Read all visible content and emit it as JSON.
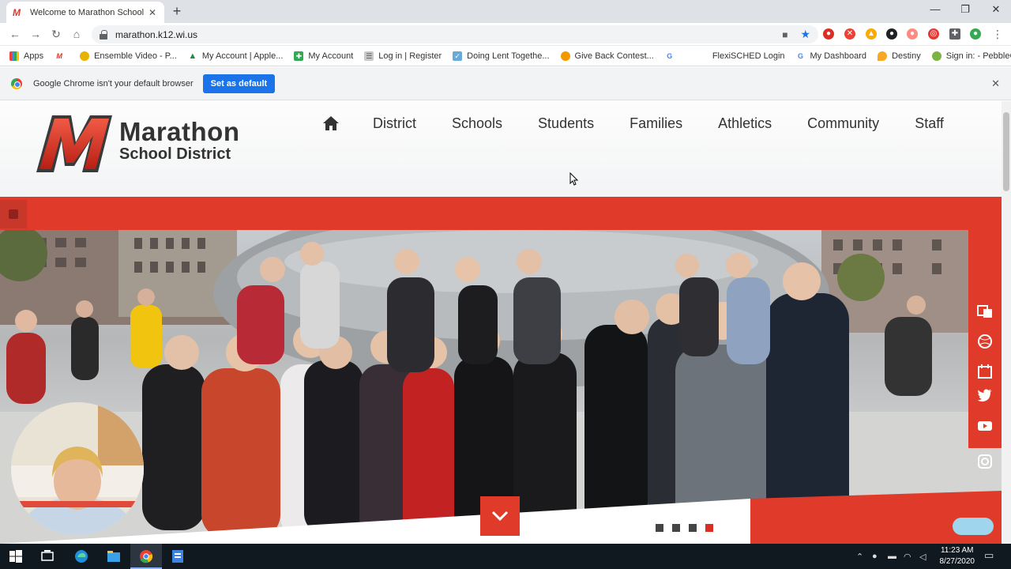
{
  "browser": {
    "tab_title": "Welcome to Marathon School Di",
    "favicon_text": "M",
    "url": "marathon.k12.wi.us",
    "bookmarks": [
      {
        "label": "Apps",
        "color": "#4285f4"
      },
      {
        "label": "",
        "color": "#d73a2f"
      },
      {
        "label": "Ensemble Video - P...",
        "color": "#e8b200"
      },
      {
        "label": "My Account | Apple...",
        "color": "#1e8e3e"
      },
      {
        "label": "My Account",
        "color": "#34a853"
      },
      {
        "label": "Log in | Register",
        "color": "#999999"
      },
      {
        "label": "Doing Lent Togethe...",
        "color": "#6aa9d8"
      },
      {
        "label": "Give Back Contest...",
        "color": "#f29900"
      },
      {
        "label": "",
        "color": "#4285f4"
      },
      {
        "label": "FlexiSCHED Login",
        "color": "#ffffff"
      },
      {
        "label": "My Dashboard",
        "color": "#4285f4"
      },
      {
        "label": "Destiny",
        "color": "#f9a825"
      },
      {
        "label": "Sign in: - PebbleGo",
        "color": "#7cb342"
      }
    ],
    "infobar_text": "Google Chrome isn't your default browser",
    "set_default_label": "Set as default"
  },
  "site": {
    "brand_name": "Marathon",
    "brand_sub": "School District",
    "nav": [
      "District",
      "Schools",
      "Students",
      "Families",
      "Athletics",
      "Community",
      "Staff"
    ],
    "accent": "#e03b2a",
    "slides_total": 4,
    "slide_active": 4
  },
  "taskbar": {
    "time": "11:23 AM",
    "date": "8/27/2020"
  }
}
